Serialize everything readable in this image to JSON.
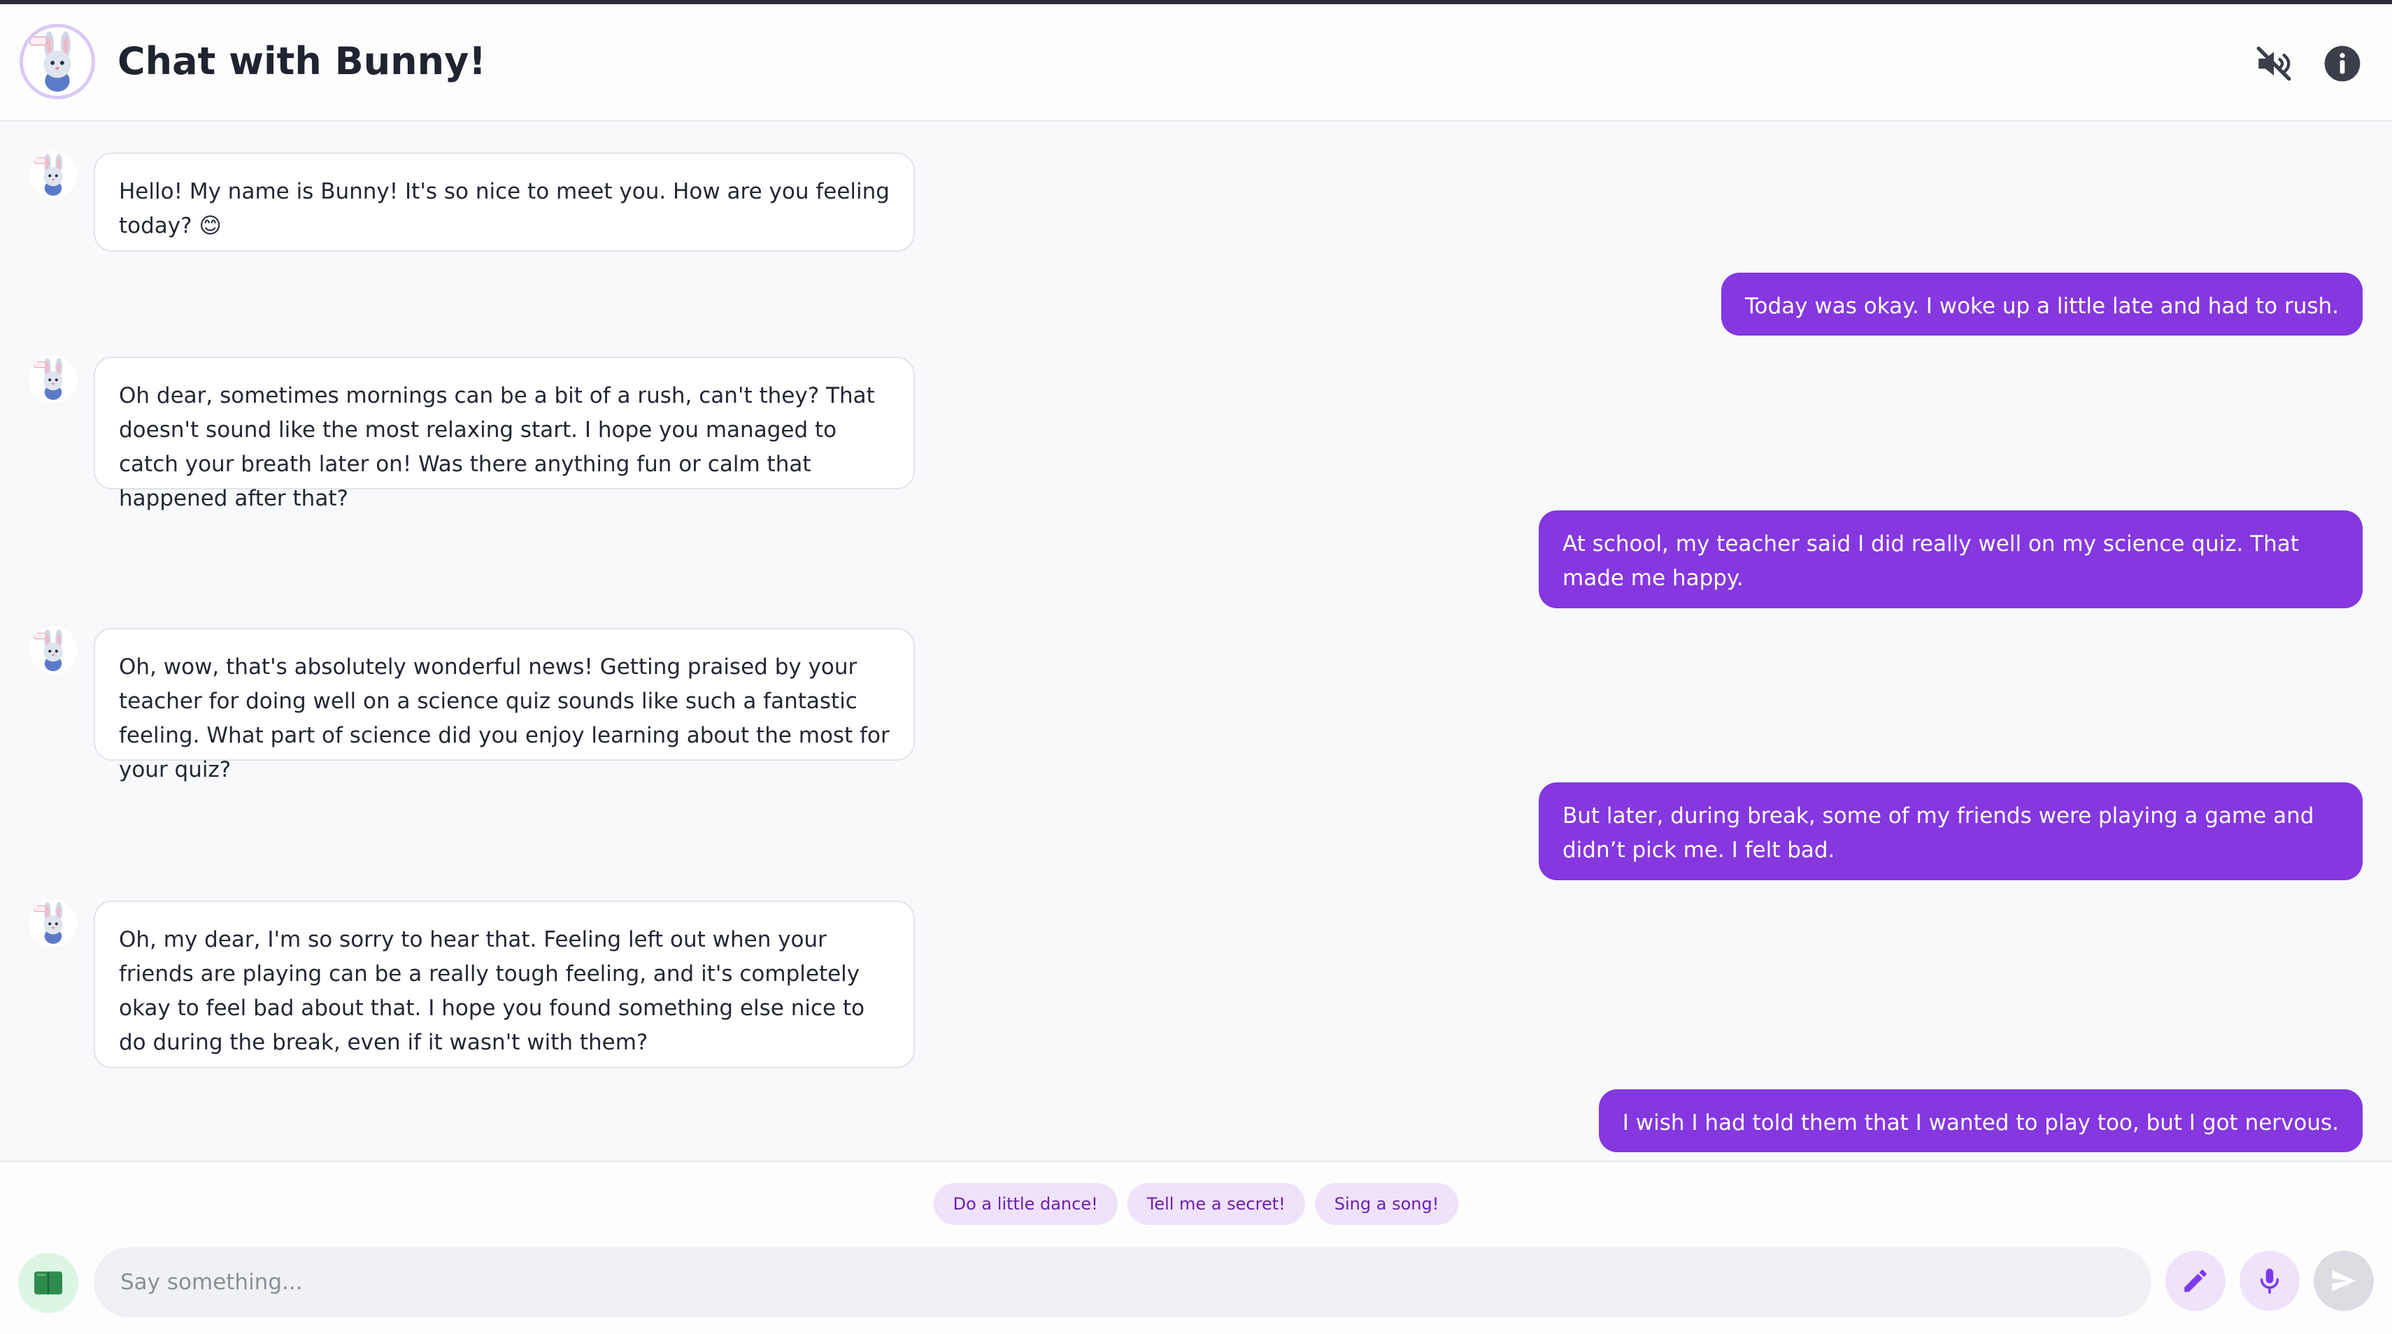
{
  "header": {
    "title": "Chat with Bunny!",
    "icons": [
      "bunny-avatar",
      "mute-icon",
      "info-icon"
    ]
  },
  "messages": [
    {
      "sender": "bot",
      "text": "Hello! My name is Bunny! It's so nice to meet you. How are you feeling today? 😊"
    },
    {
      "sender": "user",
      "text": "Today was okay. I woke up a little late and had to rush."
    },
    {
      "sender": "bot",
      "text": "Oh dear, sometimes mornings can be a bit of a rush, can't they? That doesn't sound like the most relaxing start. I hope you managed to catch your breath later on! Was there anything fun or calm that happened after that?"
    },
    {
      "sender": "user",
      "text": "At school, my teacher said I did really well on my science quiz. That made me happy."
    },
    {
      "sender": "bot",
      "text": "Oh, wow, that's absolutely wonderful news! Getting praised by your teacher for doing well on a science quiz sounds like such a fantastic feeling. What part of science did you enjoy learning about the most for your quiz?"
    },
    {
      "sender": "user",
      "text": "But later, during break, some of my friends were playing a game and didn’t pick me. I felt bad."
    },
    {
      "sender": "bot",
      "text": "Oh, my dear, I'm so sorry to hear that. Feeling left out when your friends are playing can be a really tough feeling, and it's completely okay to feel bad about that. I hope you found something else nice to do during the break, even if it wasn't with them?"
    },
    {
      "sender": "user",
      "text": "I wish I had told them that I wanted to play too, but I got nervous."
    }
  ],
  "suggestions": [
    "Do a little dance!",
    "Tell me a secret!",
    "Sing a song!"
  ],
  "composer": {
    "placeholder": "Say something...",
    "icons": [
      "book-icon",
      "pencil-icon",
      "microphone-icon",
      "send-icon"
    ]
  },
  "colors": {
    "accent": "#8537e0",
    "chip_bg": "#efe2fb",
    "chip_text": "#6b21a8",
    "book_bg": "#dcf6e3",
    "book_icon": "#2e8b4e"
  }
}
